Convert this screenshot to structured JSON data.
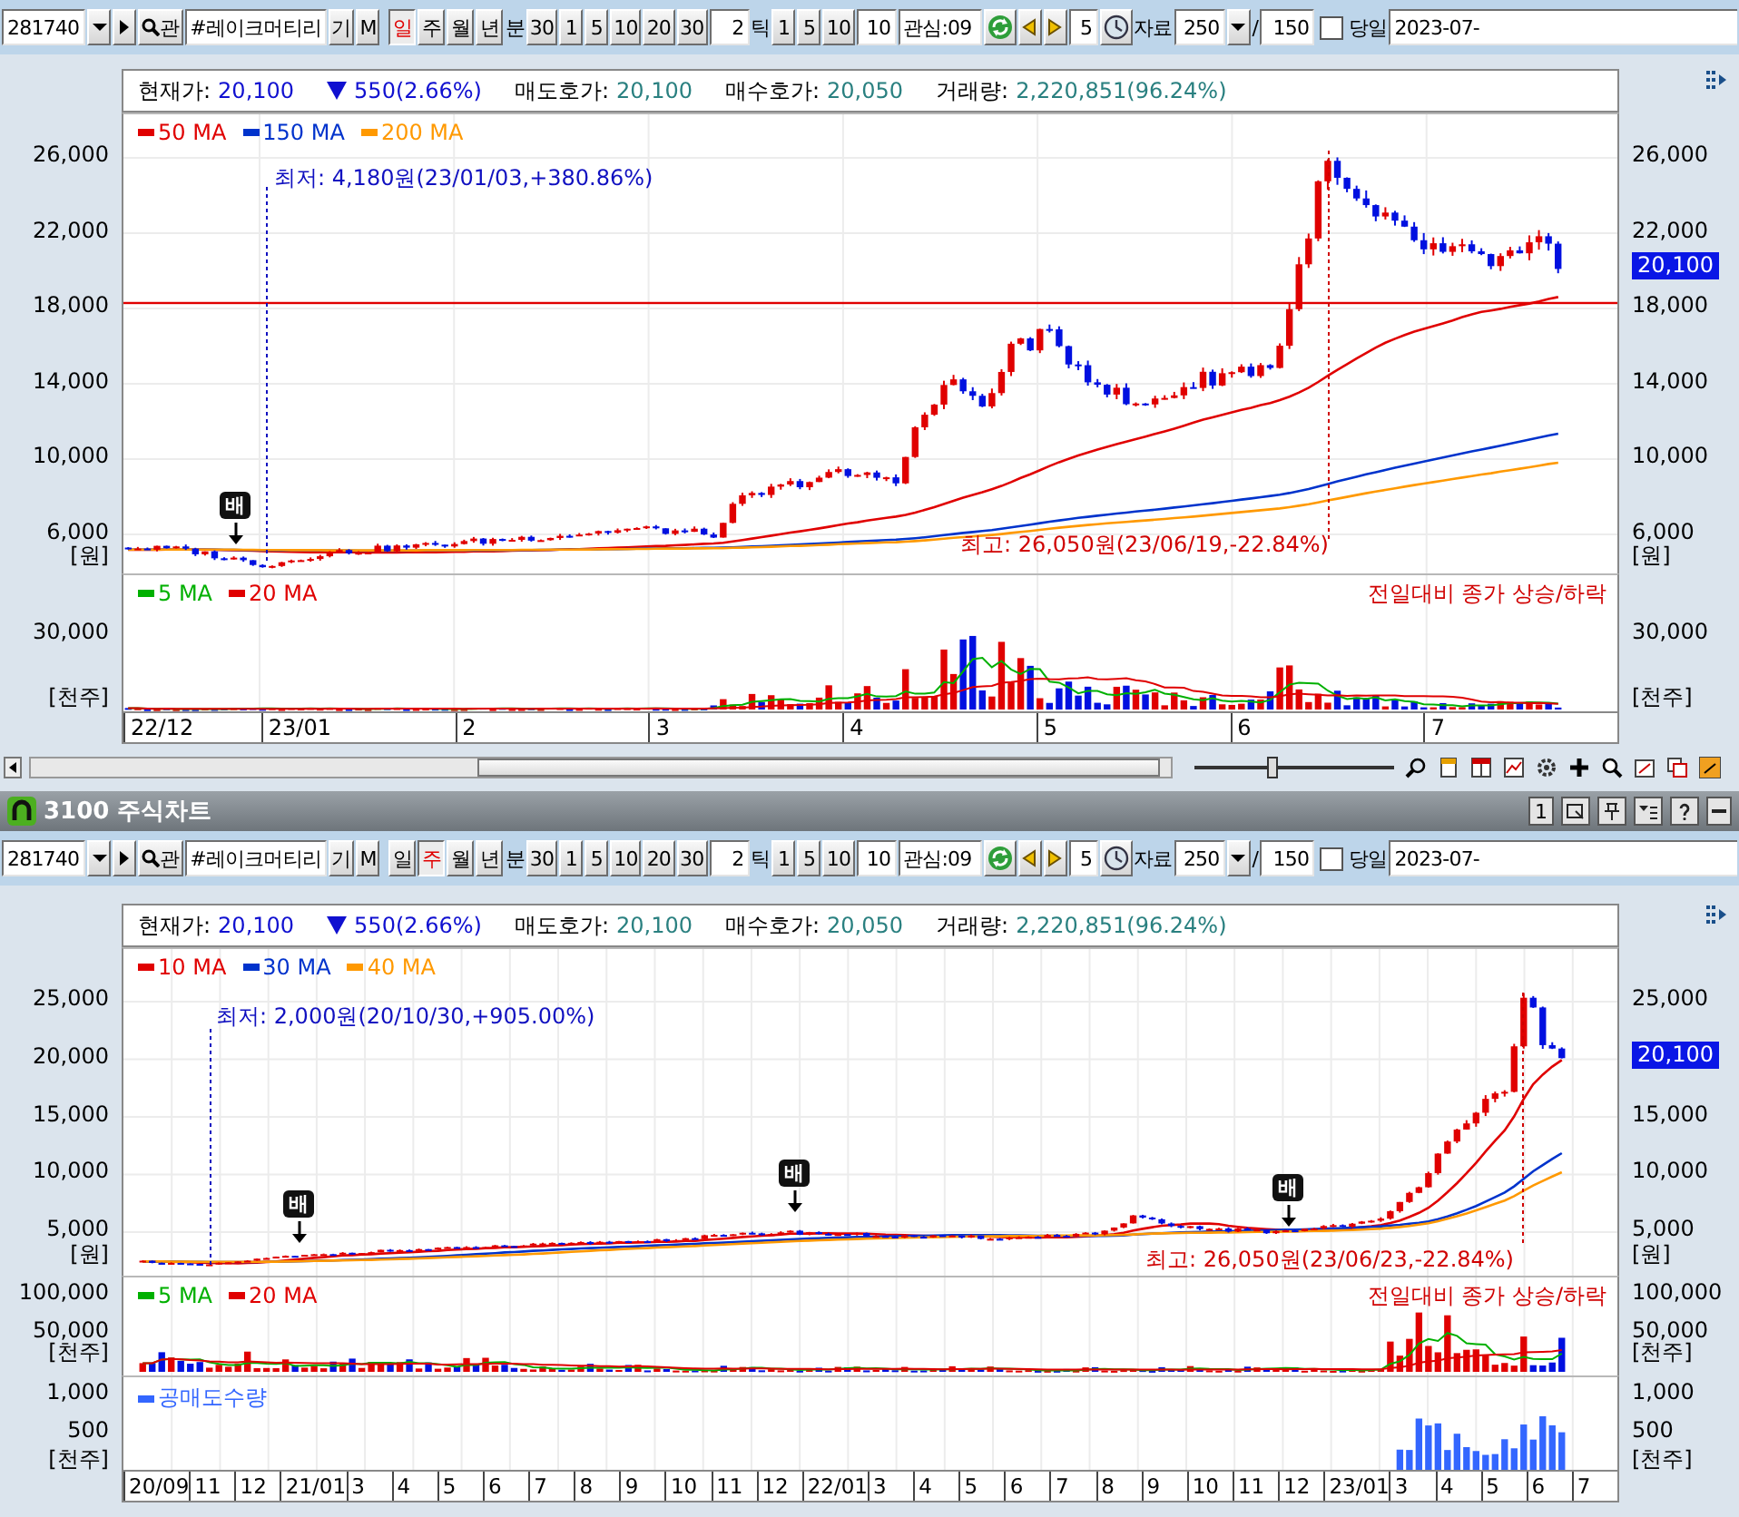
{
  "chart_top": {
    "toolbar": {
      "code": "281740",
      "lookup": "관",
      "name": "#레이크머티리",
      "name_buttons": [
        "기",
        "M"
      ],
      "periods": [
        {
          "label": "일",
          "selected": true
        },
        {
          "label": "주",
          "selected": false
        },
        {
          "label": "월",
          "selected": false
        },
        {
          "label": "년",
          "selected": false
        }
      ],
      "minute_label": "분",
      "minutes": [
        "30",
        "1",
        "5",
        "10",
        "20",
        "30"
      ],
      "minute_value": "2",
      "tick_label": "틱",
      "ticks": [
        "1",
        "5",
        "10"
      ],
      "tick_value": "10",
      "watch": "관심:09",
      "step_value": "5",
      "data_label": "자료",
      "data_count": "250",
      "slash": "/",
      "visible_count": "150",
      "today_checked": false,
      "today_label": "당일",
      "date": "2023-07-"
    },
    "quote": [
      {
        "kind": "price",
        "label": "현재가:",
        "value": "20,100"
      },
      {
        "kind": "fall",
        "value": "550(2.66%)"
      },
      {
        "kind": "field",
        "label": "매도호가:",
        "value": "20,100"
      },
      {
        "kind": "field",
        "label": "매수호가:",
        "value": "20,050"
      },
      {
        "kind": "field",
        "label": "거래량:",
        "value": "2,220,851(96.24%)"
      }
    ],
    "price": {
      "legend": [
        {
          "label": "50 MA",
          "color": "#e00000"
        },
        {
          "label": "150 MA",
          "color": "#0033cc"
        },
        {
          "label": "200 MA",
          "color": "#ff9900"
        }
      ],
      "low_note": "최저: 4,180원(23/01/03,+380.86%)",
      "high_note": "최고: 26,050원(23/06/19,-22.84%)",
      "markers": [
        "배"
      ],
      "level_line": true,
      "left_axis": {
        "ticks": [
          "26,000",
          "22,000",
          "18,000",
          "14,000",
          "10,000",
          "6,000"
        ],
        "unit": "[원]"
      },
      "right_axis": {
        "ticks": [
          "26,000",
          "22,000",
          "18,000",
          "14,000",
          "10,000",
          "6,000"
        ],
        "unit": "[원]"
      },
      "price_tag": "20,100"
    },
    "volume": {
      "legend": [
        {
          "label": "5 MA",
          "color": "#00b000"
        },
        {
          "label": "20 MA",
          "color": "#e00000"
        }
      ],
      "note": "전일대비 종가 상승/하락",
      "left_axis": {
        "ticks": [
          "30,000"
        ],
        "unit": "[천주]"
      },
      "right_axis": {
        "ticks": [
          "30,000"
        ],
        "unit": "[천주]"
      }
    },
    "x_labels": [
      "22/12",
      "23/01",
      "2",
      "3",
      "4",
      "5",
      "6",
      "7"
    ]
  },
  "scroll_row": {
    "zoom_slider": {
      "level": 0.39
    }
  },
  "window": {
    "title": "3100 주식차트",
    "page_button": "1"
  },
  "chart_bottom": {
    "toolbar": {
      "code": "281740",
      "lookup": "관",
      "name": "#레이크머티리",
      "name_buttons": [
        "기",
        "M"
      ],
      "periods": [
        {
          "label": "일",
          "selected": false
        },
        {
          "label": "주",
          "selected": true
        },
        {
          "label": "월",
          "selected": false
        },
        {
          "label": "년",
          "selected": false
        }
      ],
      "minute_label": "분",
      "minutes": [
        "30",
        "1",
        "5",
        "10",
        "20",
        "30"
      ],
      "minute_value": "2",
      "tick_label": "틱",
      "ticks": [
        "1",
        "5",
        "10"
      ],
      "tick_value": "10",
      "watch": "관심:09",
      "step_value": "5",
      "data_label": "자료",
      "data_count": "250",
      "slash": "/",
      "visible_count": "150",
      "today_checked": false,
      "today_label": "당일",
      "date": "2023-07-"
    },
    "quote": [
      {
        "kind": "price",
        "label": "현재가:",
        "value": "20,100"
      },
      {
        "kind": "fall",
        "value": "550(2.66%)"
      },
      {
        "kind": "field",
        "label": "매도호가:",
        "value": "20,100"
      },
      {
        "kind": "field",
        "label": "매수호가:",
        "value": "20,050"
      },
      {
        "kind": "field",
        "label": "거래량:",
        "value": "2,220,851(96.24%)"
      }
    ],
    "price": {
      "legend": [
        {
          "label": "10 MA",
          "color": "#e00000"
        },
        {
          "label": "30 MA",
          "color": "#0033cc"
        },
        {
          "label": "40 MA",
          "color": "#ff9900"
        }
      ],
      "low_note": "최저: 2,000원(20/10/30,+905.00%)",
      "high_note": "최고: 26,050원(23/06/23,-22.84%)",
      "markers": [
        "배",
        "배",
        "배"
      ],
      "level_line": false,
      "left_axis": {
        "ticks": [
          "25,000",
          "20,000",
          "15,000",
          "10,000",
          "5,000"
        ],
        "unit": "[원]"
      },
      "right_axis": {
        "ticks": [
          "25,000",
          "15,000",
          "10,000",
          "5,000"
        ],
        "unit": "[원]"
      },
      "price_tag": "20,100"
    },
    "volume": {
      "legend": [
        {
          "label": "5 MA",
          "color": "#00b000"
        },
        {
          "label": "20 MA",
          "color": "#e00000"
        }
      ],
      "note": "전일대비 종가 상승/하락",
      "left_axis": {
        "ticks": [
          "100,000",
          "50,000"
        ],
        "unit": "[천주]"
      },
      "right_axis": {
        "ticks": [
          "100,000",
          "50,000"
        ],
        "unit": "[천주]"
      }
    },
    "short_selling": {
      "legend": [
        {
          "label": "공매도수량",
          "color": "#3366ff"
        }
      ],
      "left_axis": {
        "ticks": [
          "1,000",
          "500"
        ],
        "unit": "[천주]"
      },
      "right_axis": {
        "ticks": [
          "1,000",
          "500"
        ],
        "unit": "[천주]"
      }
    },
    "x_labels": [
      "20/09",
      "11",
      "12",
      "21/01",
      "3",
      "4",
      "5",
      "6",
      "7",
      "8",
      "9",
      "10",
      "11",
      "12",
      "22/01",
      "3",
      "4",
      "5",
      "6",
      "7",
      "8",
      "9",
      "10",
      "11",
      "12",
      "23/01",
      "3",
      "4",
      "5",
      "6",
      "7"
    ]
  }
}
